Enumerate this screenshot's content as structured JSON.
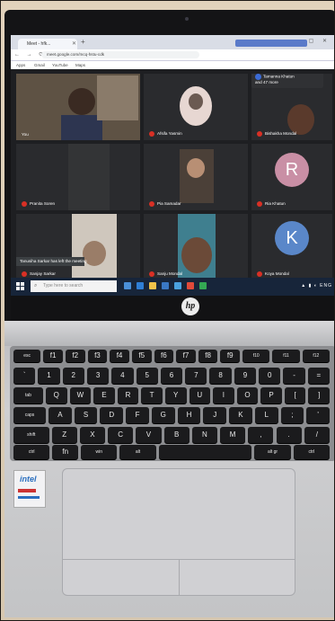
{
  "browser": {
    "tab_label": "Meet - hfk...",
    "url": "meet.google.com/mcq-hstu-cdk",
    "bookmarks": [
      "Apps",
      "Gmail",
      "YouTube",
      "Maps"
    ]
  },
  "meet": {
    "notice_name": "Tamanna Khatun",
    "notice_more": "and 47 more",
    "notice_badge": "T",
    "toast": "Tanusiha Sarkar has left the meeting",
    "participants": [
      {
        "name": "You"
      },
      {
        "name": "Afsifa Yasmin"
      },
      {
        "name": "Bishakha Mondal"
      },
      {
        "name": "Pranita Soren"
      },
      {
        "name": "Pia Samadar"
      },
      {
        "name": "Ria Khatun",
        "initial": "R",
        "color": "#c98fa5"
      },
      {
        "name": "Sanjay Sarkar"
      },
      {
        "name": "Sanju Mondal"
      },
      {
        "name": "Koya Mondal",
        "initial": "K",
        "color": "#5a87c9"
      }
    ]
  },
  "taskbar": {
    "search_placeholder": "Type here to search",
    "tray_text": "ENG"
  },
  "laptop": {
    "brand_logo": "hp",
    "keyboard_rows": [
      [
        "esc",
        "f1",
        "f2",
        "f3",
        "f4",
        "f5",
        "f6",
        "f7",
        "f8",
        "f9",
        "f10",
        "f11",
        "f12"
      ],
      [
        "`",
        "1",
        "2",
        "3",
        "4",
        "5",
        "6",
        "7",
        "8",
        "9",
        "0",
        "-",
        "="
      ],
      [
        "tab",
        "Q",
        "W",
        "E",
        "R",
        "T",
        "Y",
        "U",
        "I",
        "O",
        "P",
        "[",
        "]"
      ],
      [
        "caps",
        "A",
        "S",
        "D",
        "F",
        "G",
        "H",
        "J",
        "K",
        "L",
        ";",
        "'"
      ],
      [
        "shift",
        "Z",
        "X",
        "C",
        "V",
        "B",
        "N",
        "M",
        ",",
        ".",
        "/"
      ],
      [
        "ctrl",
        "fn",
        "win",
        "alt",
        "",
        "alt gr",
        "ctrl"
      ]
    ]
  }
}
